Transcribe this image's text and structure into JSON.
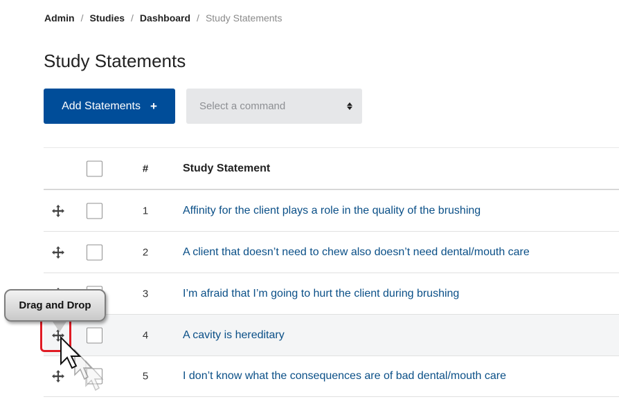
{
  "breadcrumb": {
    "items": [
      "Admin",
      "Studies",
      "Dashboard"
    ],
    "current": "Study Statements",
    "separator": "/"
  },
  "page": {
    "title": "Study Statements"
  },
  "toolbar": {
    "add_label": "Add Statements",
    "add_icon": "plus-icon",
    "command_placeholder": "Select a command"
  },
  "table": {
    "headers": {
      "number": "#",
      "statement": "Study Statement"
    },
    "rows": [
      {
        "number": "1",
        "statement": "Affinity for the client plays a role in the quality of the brushing"
      },
      {
        "number": "2",
        "statement": "A client that doesn’t need to chew also doesn’t need dental/mouth care"
      },
      {
        "number": "3",
        "statement": "I’m afraid that I’m going to hurt the client during brushing"
      },
      {
        "number": "4",
        "statement": "A cavity is hereditary"
      },
      {
        "number": "5",
        "statement": "I don’t know what the consequences are of bad dental/mouth care"
      }
    ]
  },
  "annotation": {
    "tooltip": "Drag and Drop"
  },
  "colors": {
    "primary": "#004d99",
    "link": "#0a4f87",
    "highlight": "#e01b24"
  }
}
